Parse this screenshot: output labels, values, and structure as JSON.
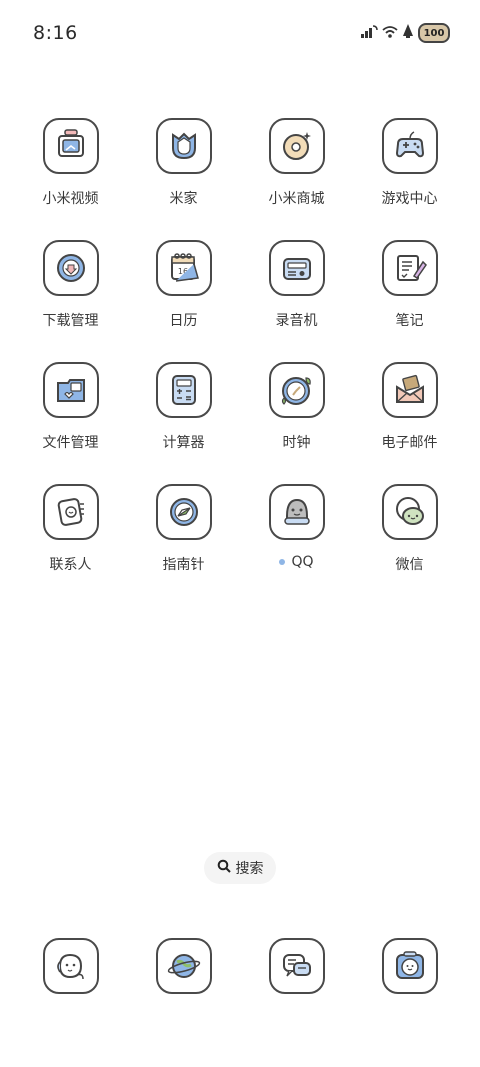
{
  "status_bar": {
    "time": "8:16",
    "battery_level": "100",
    "icons": [
      "signal-icon",
      "wifi-icon",
      "notification-icon",
      "battery-icon"
    ]
  },
  "apps": [
    {
      "label": "小米视频",
      "icon": "video-icon",
      "color": "#8fb6e6",
      "dot": false
    },
    {
      "label": "米家",
      "icon": "mijia-icon",
      "color": "#8fb6e6",
      "dot": false
    },
    {
      "label": "小米商城",
      "icon": "mall-icon",
      "color": "#f2dcb8",
      "dot": false
    },
    {
      "label": "游戏中心",
      "icon": "gamepad-icon",
      "color": "#c9dcf3",
      "dot": false
    },
    {
      "label": "下载管理",
      "icon": "download-icon",
      "color": "#8fb6e6",
      "dot": false
    },
    {
      "label": "日历",
      "icon": "calendar-icon",
      "color": "#f2dcb8",
      "dot": false
    },
    {
      "label": "录音机",
      "icon": "recorder-icon",
      "color": "#c9dcf3",
      "dot": false
    },
    {
      "label": "笔记",
      "icon": "notes-icon",
      "color": "#d8b4e6",
      "dot": false
    },
    {
      "label": "文件管理",
      "icon": "folder-icon",
      "color": "#8fb6e6",
      "dot": false
    },
    {
      "label": "计算器",
      "icon": "calculator-icon",
      "color": "#c9dcf3",
      "dot": false
    },
    {
      "label": "时钟",
      "icon": "clock-icon",
      "color": "#8fb6e6",
      "dot": false
    },
    {
      "label": "电子邮件",
      "icon": "mail-icon",
      "color": "#f2c9b8",
      "dot": false
    },
    {
      "label": "联系人",
      "icon": "contacts-icon",
      "color": "#ffffff",
      "dot": false
    },
    {
      "label": "指南针",
      "icon": "compass-icon",
      "color": "#8fb6e6",
      "dot": false
    },
    {
      "label": "QQ",
      "icon": "penguin-icon",
      "color": "#c9dcf3",
      "dot": true
    },
    {
      "label": "微信",
      "icon": "wechat-icon",
      "color": "#cfe3c0",
      "dot": false
    }
  ],
  "search": {
    "label": "搜索"
  },
  "dock": [
    {
      "icon": "dog-icon",
      "color": "#c9dcf3"
    },
    {
      "icon": "browser-icon",
      "color": "#8fb6e6"
    },
    {
      "icon": "messages-icon",
      "color": "#c9dcf3"
    },
    {
      "icon": "camera-icon",
      "color": "#8fb6e6"
    }
  ],
  "colors": {
    "accent": "#8fb6e6",
    "outline": "#4a4a4a",
    "dot": "#8fb6e6"
  }
}
